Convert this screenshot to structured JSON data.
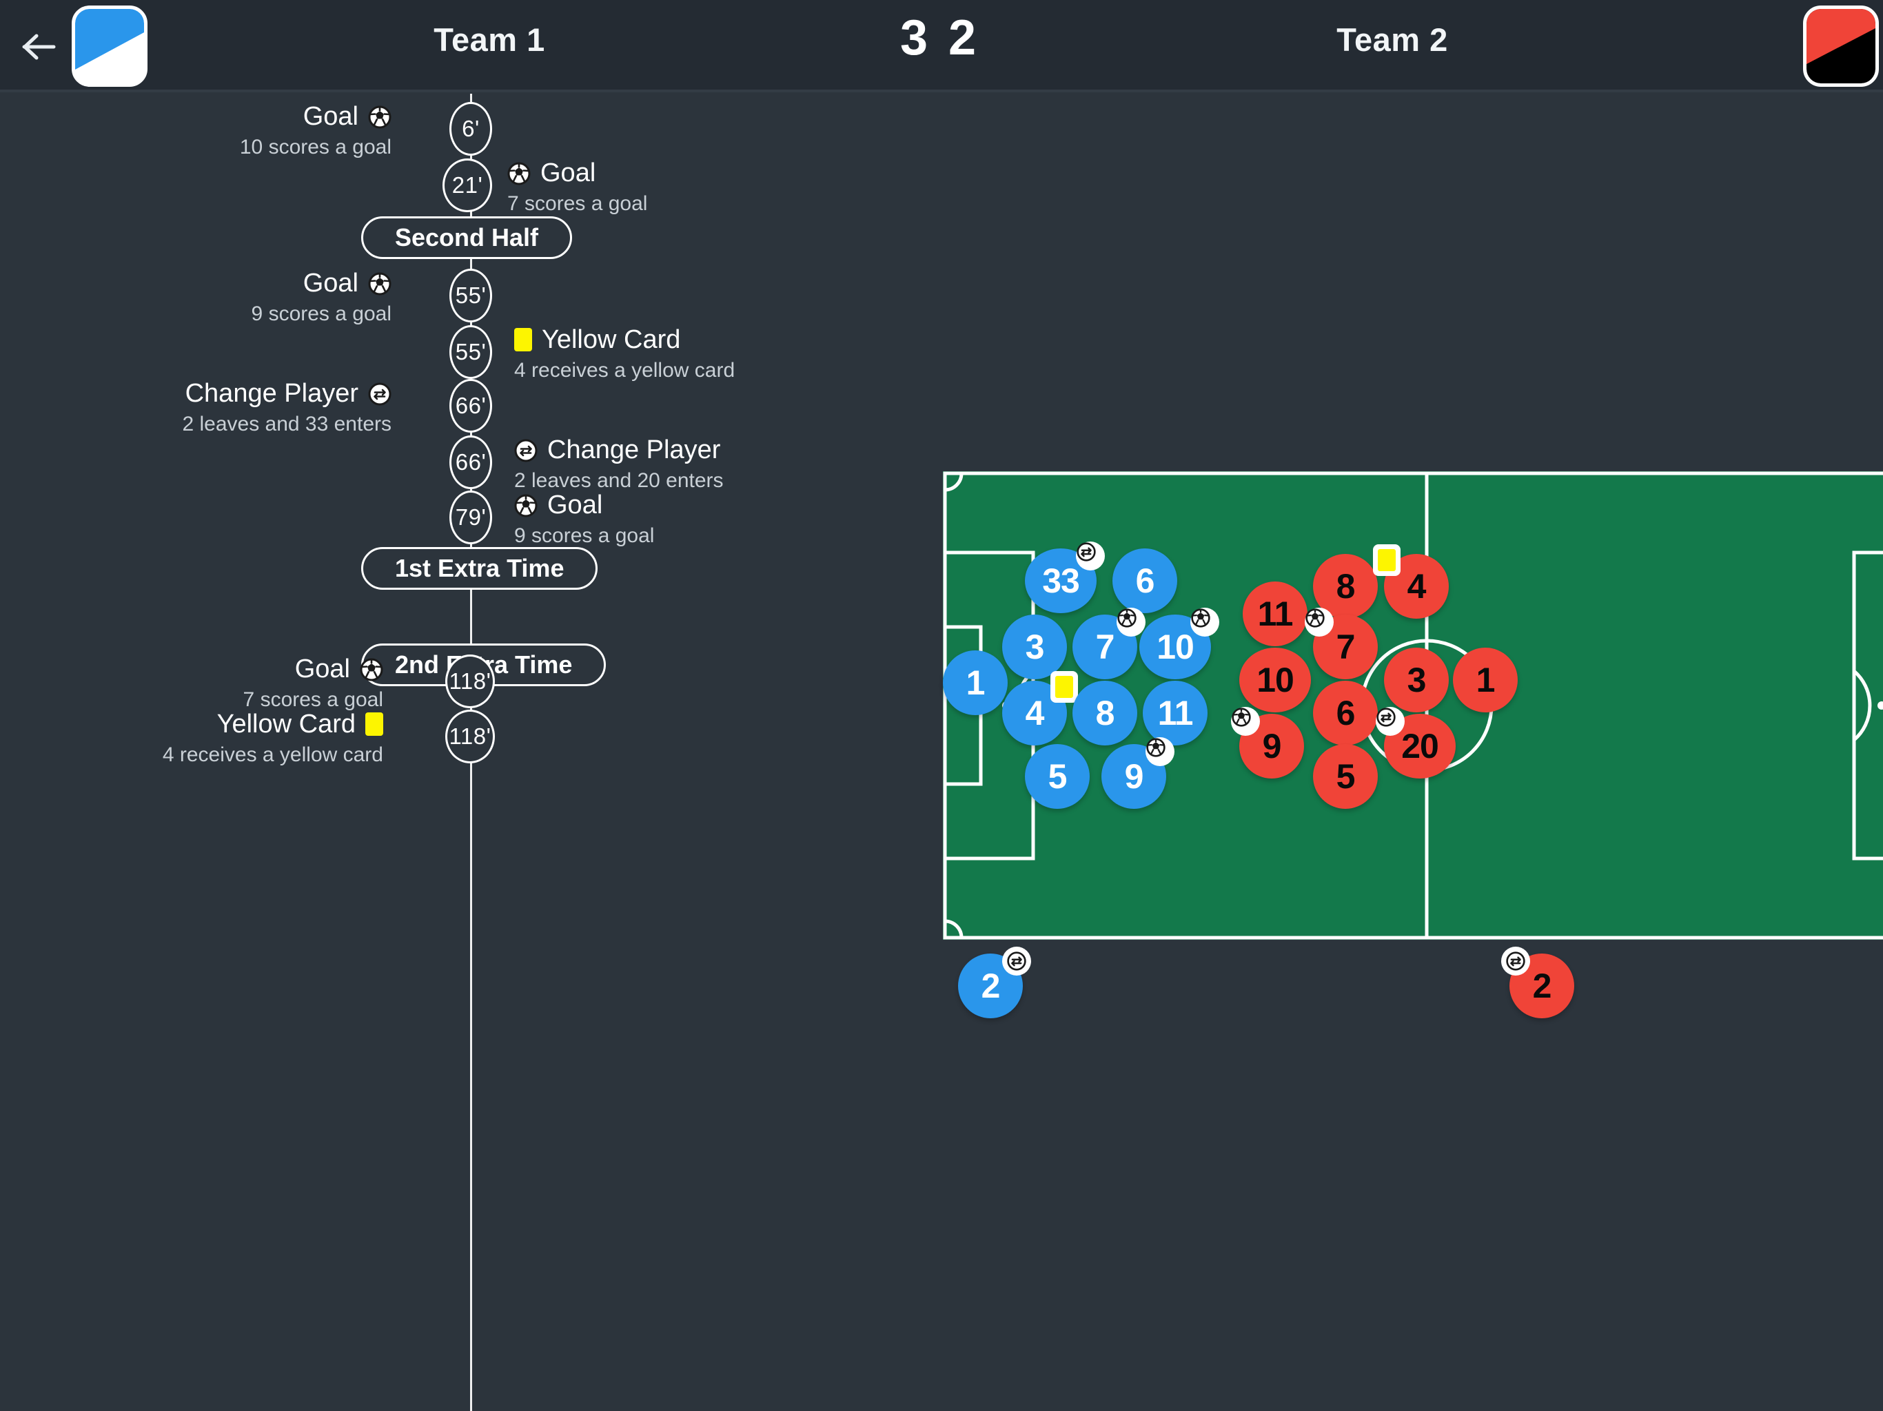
{
  "header": {
    "back_icon": "back-arrow-icon",
    "home_team": "Team 1",
    "away_team": "Team 2",
    "home_score": "3",
    "away_score": "2",
    "home_badge_colors": {
      "primary": "#2a96eb",
      "secondary": "#ffffff"
    },
    "away_badge_colors": {
      "primary": "#f04438",
      "secondary": "#000000"
    }
  },
  "timeline": {
    "events": [
      {
        "minute": "6'",
        "side": "left",
        "type": "goal",
        "icon": "football-icon",
        "title": "Goal",
        "detail": "10 scores a goal"
      },
      {
        "minute": "21'",
        "side": "right",
        "type": "goal",
        "icon": "football-icon",
        "title": "Goal",
        "detail": "7 scores a goal"
      },
      {
        "phase": "Second Half"
      },
      {
        "minute": "55'",
        "side": "left",
        "type": "goal",
        "icon": "football-icon",
        "title": "Goal",
        "detail": "9 scores a goal"
      },
      {
        "minute": "55'",
        "side": "right",
        "type": "card",
        "icon": "yellow-card-icon",
        "title": "Yellow Card",
        "detail": "4 receives a yellow card"
      },
      {
        "minute": "66'",
        "side": "left",
        "type": "sub",
        "icon": "substitution-icon",
        "title": "Change Player",
        "detail": "2 leaves and 33 enters"
      },
      {
        "minute": "66'",
        "side": "right",
        "type": "sub",
        "icon": "substitution-icon",
        "title": "Change Player",
        "detail": "2 leaves and 20 enters"
      },
      {
        "minute": "79'",
        "side": "right",
        "type": "goal",
        "icon": "football-icon",
        "title": "Goal",
        "detail": "9 scores a goal"
      },
      {
        "phase": "1st Extra Time"
      },
      {
        "phase": "2nd Extra Time"
      },
      {
        "minute": "118'",
        "side": "left",
        "type": "goal",
        "icon": "football-icon",
        "title": "Goal",
        "detail": "7 scores a goal"
      },
      {
        "minute": "118'",
        "side": "left",
        "type": "card",
        "icon": "yellow-card-icon",
        "title": "Yellow Card",
        "detail": "4 receives a yellow card"
      }
    ]
  },
  "pitch": {
    "home": {
      "color": "#2a96eb",
      "text_color": "#ffffff",
      "players": [
        {
          "number": "1",
          "badge": "none"
        },
        {
          "number": "33",
          "badge": "substitution-icon"
        },
        {
          "number": "6",
          "badge": "none"
        },
        {
          "number": "3",
          "badge": "none"
        },
        {
          "number": "7",
          "badge": "football-icon"
        },
        {
          "number": "10",
          "badge": "football-icon"
        },
        {
          "number": "4",
          "badge": "yellow-card-icon"
        },
        {
          "number": "8",
          "badge": "none"
        },
        {
          "number": "11",
          "badge": "none"
        },
        {
          "number": "5",
          "badge": "none"
        },
        {
          "number": "9",
          "badge": "football-icon"
        }
      ],
      "bench": [
        {
          "number": "2",
          "badge": "substitution-icon"
        }
      ]
    },
    "away": {
      "color": "#f04438",
      "text_color": "#0a0a0a",
      "players": [
        {
          "number": "8",
          "badge": "none"
        },
        {
          "number": "11",
          "badge": "none"
        },
        {
          "number": "4",
          "badge": "yellow-card-icon"
        },
        {
          "number": "7",
          "badge": "football-icon"
        },
        {
          "number": "10",
          "badge": "none"
        },
        {
          "number": "3",
          "badge": "none"
        },
        {
          "number": "1",
          "badge": "none"
        },
        {
          "number": "6",
          "badge": "none"
        },
        {
          "number": "9",
          "badge": "football-icon"
        },
        {
          "number": "20",
          "badge": "substitution-icon"
        },
        {
          "number": "5",
          "badge": "none"
        }
      ],
      "bench": [
        {
          "number": "2",
          "badge": "substitution-icon"
        }
      ]
    },
    "field_color": "#13794b",
    "line_color": "#ffffff"
  }
}
